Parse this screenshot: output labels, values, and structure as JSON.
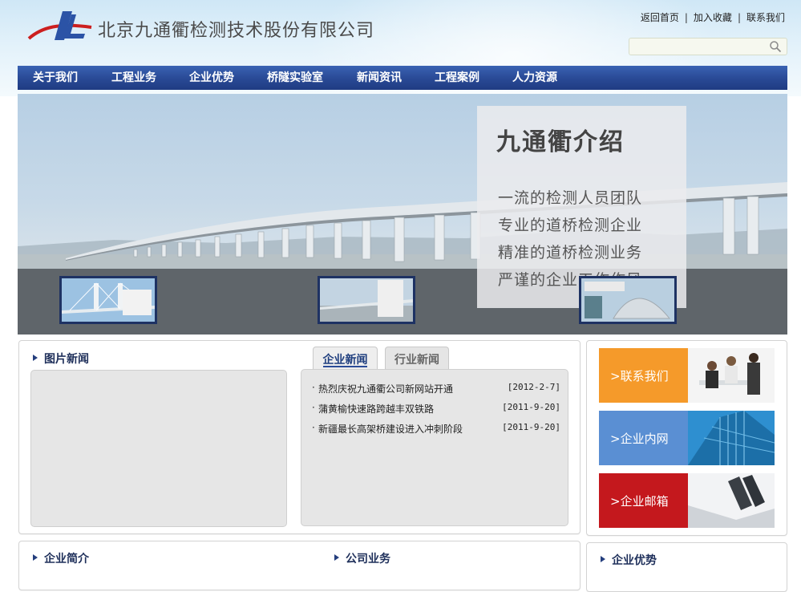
{
  "header": {
    "company_name": "北京九通衢检测技术股份有限公司",
    "links": [
      "返回首页",
      "加入收藏",
      "联系我们"
    ],
    "search_placeholder": ""
  },
  "nav": {
    "items": [
      "关于我们",
      "工程业务",
      "企业优势",
      "桥隧实验室",
      "新闻资讯",
      "工程案例",
      "人力资源"
    ]
  },
  "banner": {
    "intro_title": "九通衢介绍",
    "lines": [
      "一流的检测人员团队",
      "专业的道桥检测企业",
      "精准的道桥检测业务",
      "严谨的企业工作作风"
    ]
  },
  "photo_news": {
    "title": "图片新闻"
  },
  "news_tabs": {
    "active": "企业新闻",
    "inactive": "行业新闻"
  },
  "news": [
    {
      "title": "热烈庆祝九通衢公司新网站开通",
      "date": "[2012-2-7]"
    },
    {
      "title": "蒲黄榆快速路跨越丰双铁路",
      "date": "[2011-9-20]"
    },
    {
      "title": "新疆最长高架桥建设进入冲刺阶段",
      "date": "[2011-9-20]"
    }
  ],
  "quick_links": [
    {
      "label": ">联系我们",
      "color": "#f59a2a"
    },
    {
      "label": ">企业内网",
      "color": "#5a8fd3"
    },
    {
      "label": ">企业邮箱",
      "color": "#c4181d"
    }
  ],
  "bottom_sections": [
    "企业简介",
    "公司业务",
    "企业优势"
  ],
  "colors": {
    "nav": "#2a4b97",
    "title": "#1e2f5a"
  }
}
